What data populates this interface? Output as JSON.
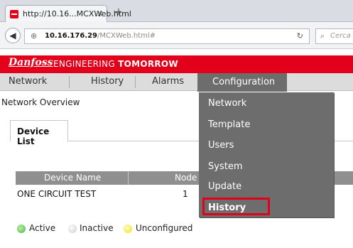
{
  "browser": {
    "tab_title": "http://10.16...MCXWeb.html",
    "close_glyph": "×",
    "new_tab_glyph": "+",
    "url_host": "10.16.176.29",
    "url_path": "/MCXWeb.html#",
    "search_placeholder": "Cerca"
  },
  "brand": {
    "logo": "Danfoss",
    "tagline_light": "ENGINEERING",
    "tagline_bold": "TOMORROW",
    "color": "#e2001a"
  },
  "menu": {
    "items": [
      "Network",
      "History",
      "Alarms",
      "Configuration"
    ],
    "active": "Configuration",
    "active_color": "#6d6d6d"
  },
  "page": {
    "breadcrumb": "Network Overview",
    "tab": "Device List"
  },
  "device_table": {
    "columns": [
      "Device Name",
      "Node ID"
    ],
    "rows": [
      {
        "name": "ONE CIRCUIT TEST",
        "node": "1"
      }
    ]
  },
  "legend": {
    "items": [
      {
        "label": "Active",
        "color": "#4db34d"
      },
      {
        "label": "Inactive",
        "color": "#c8c8c8"
      },
      {
        "label": "Unconfigured",
        "color": "#f0e000"
      }
    ]
  },
  "dropdown": {
    "items": [
      "Network",
      "Template",
      "Users",
      "System",
      "Update",
      "History"
    ],
    "highlighted": "History",
    "highlight_color": "#e2001a"
  }
}
